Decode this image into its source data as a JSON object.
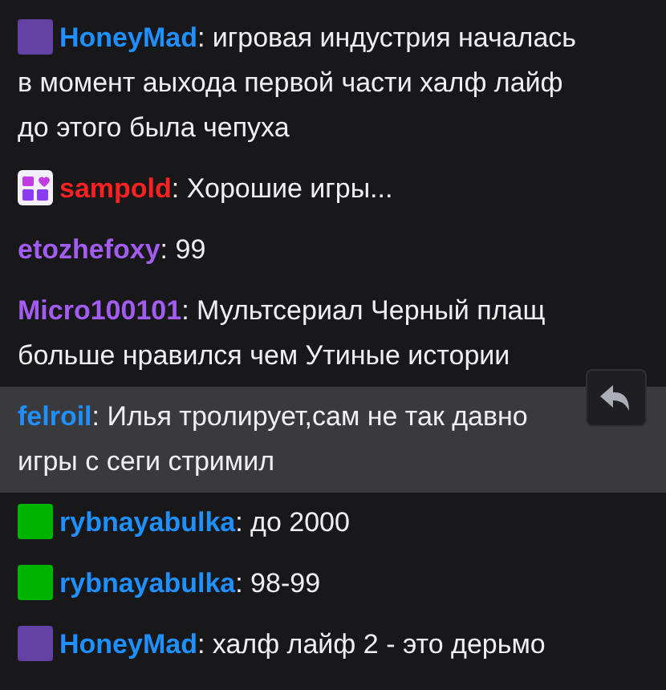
{
  "messages": [
    {
      "badge": {
        "kind": "square",
        "color": "#6441a5"
      },
      "user": "HoneyMad",
      "color": "#1e90ff",
      "lines": [
        ": игровая индустрия началась",
        "в момент аыхода первой части халф лайф",
        "до этого была чепуха"
      ],
      "highlighted": false
    },
    {
      "badge": {
        "kind": "year"
      },
      "user": "sampold",
      "color": "#ff2020",
      "lines": [
        ": Хорошие игры..."
      ],
      "highlighted": false
    },
    {
      "user": "etozhefoxy",
      "color": "#a35cf0",
      "lines": [
        ": 99"
      ],
      "highlighted": false
    },
    {
      "user": "Micro100101",
      "color": "#a35cf0",
      "lines": [
        ": Мультсериал Черный плащ",
        "больше нравился чем Утиные истории"
      ],
      "highlighted": false
    },
    {
      "user": "felroil",
      "color": "#1e90ff",
      "lines": [
        ": Илья тролирует,сам не так давно",
        "игры с сеги стримил"
      ],
      "highlighted": true
    },
    {
      "badge": {
        "kind": "square",
        "color": "#00b400"
      },
      "user": "rybnayabulka",
      "color": "#1e90ff",
      "lines": [
        ": до 2000"
      ],
      "highlighted": false
    },
    {
      "badge": {
        "kind": "square",
        "color": "#00b400"
      },
      "user": "rybnayabulka",
      "color": "#1e90ff",
      "lines": [
        ": 98-99"
      ],
      "highlighted": false
    },
    {
      "badge": {
        "kind": "square",
        "color": "#6441a5"
      },
      "user": "HoneyMad",
      "color": "#1e90ff",
      "lines": [
        ": халф лайф 2 - это дерьмо"
      ],
      "highlighted": false
    }
  ]
}
